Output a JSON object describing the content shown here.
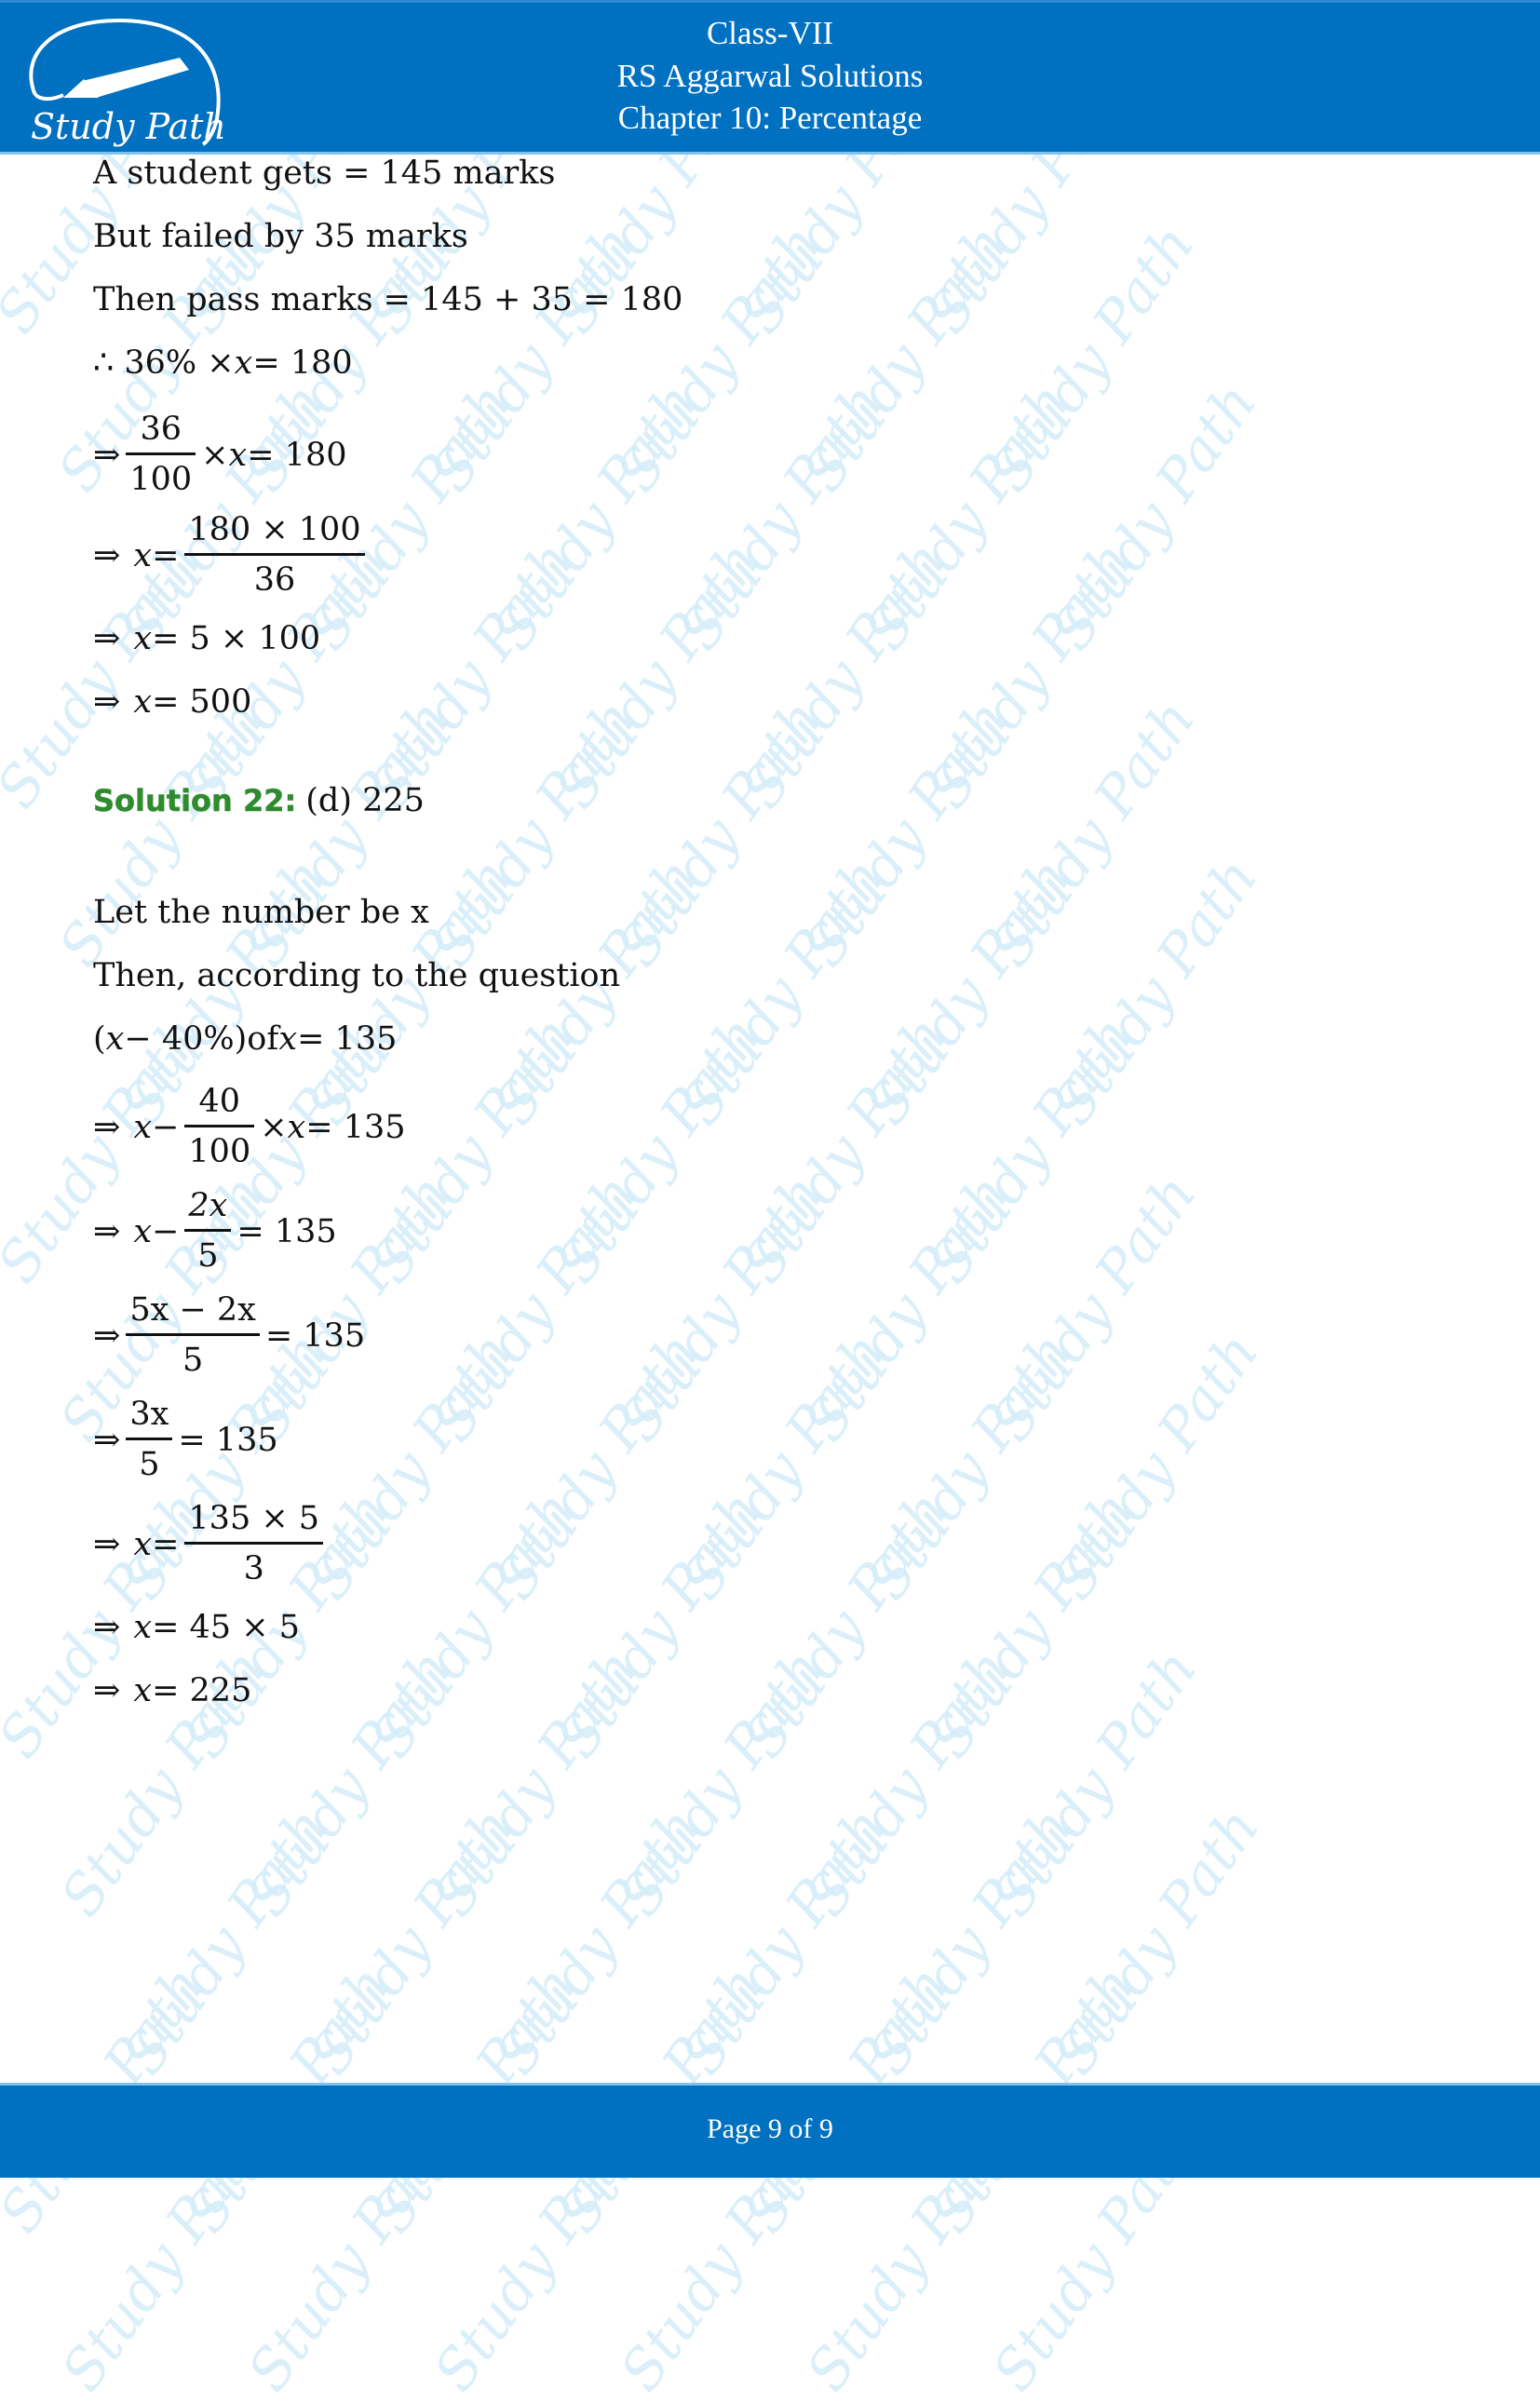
{
  "header": {
    "class": "Class-VII",
    "book": "RS Aggarwal Solutions",
    "chapter": "Chapter 10: Percentage",
    "logo_text": "Study Path"
  },
  "watermark_text": "Study Path",
  "colors": {
    "header_bg": "#0070c0",
    "solution_label": "#2e8b2e",
    "watermark": "#d6eef9"
  },
  "part1": {
    "l1": "A student gets = 145 marks",
    "l2": "But failed by 35 marks",
    "l3": "Then pass marks = 145 + 35 = 180",
    "l4": {
      "prefix": "∴ 36% × ",
      "var": "x",
      "suffix": " = 180"
    },
    "l5": {
      "arrow": "⇒",
      "num": "36",
      "den": "100",
      "mid": "× ",
      "var": "x",
      "suffix": " = 180"
    },
    "l6": {
      "arrow": "⇒",
      "var": "x",
      "eq": " = ",
      "num": "180 × 100",
      "den": "36"
    },
    "l7": {
      "arrow": "⇒",
      "var": "x",
      "suffix": " = 5 × 100"
    },
    "l8": {
      "arrow": "⇒",
      "var": "x",
      "suffix": " = 500"
    }
  },
  "solution22": {
    "label": "Solution 22:",
    "answer": "(d) 225",
    "l1": "Let the number be x",
    "l2": "Then, according to the question",
    "l3": {
      "open": "(",
      "var": "x",
      "mid": " − 40%)of ",
      "var2": "x",
      "suffix": " = 135"
    },
    "l4": {
      "arrow": "⇒",
      "var": "x",
      "minus": " − ",
      "num": "40",
      "den": "100",
      "mid": "× ",
      "var2": "x",
      "suffix": " = 135"
    },
    "l5": {
      "arrow": "⇒",
      "var": "x",
      "minus": " − ",
      "num": "2x",
      "den": "5",
      "suffix": "= 135"
    },
    "l6": {
      "arrow": "⇒",
      "num": "5x − 2x",
      "den": "5",
      "suffix": "= 135"
    },
    "l7": {
      "arrow": "⇒",
      "num": "3x",
      "den": "5",
      "suffix": "= 135"
    },
    "l8": {
      "arrow": "⇒",
      "var": "x",
      "eq": " = ",
      "num": "135 × 5",
      "den": "3"
    },
    "l9": {
      "arrow": "⇒",
      "var": "x",
      "suffix": " = 45 × 5"
    },
    "l10": {
      "arrow": "⇒",
      "var": "x",
      "suffix": " = 225"
    }
  },
  "footer": {
    "page": "Page 9 of 9"
  }
}
